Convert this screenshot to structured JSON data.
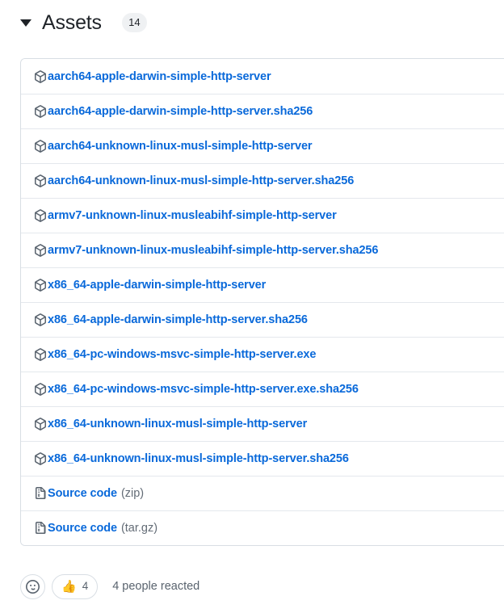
{
  "assets_section": {
    "title": "Assets",
    "count": "14",
    "disclosure_state": "expanded",
    "disclosure_icon": "triangle-down-icon"
  },
  "assets": [
    {
      "icon": "package-icon",
      "name": "aarch64-apple-darwin-simple-http-server",
      "suffix": ""
    },
    {
      "icon": "package-icon",
      "name": "aarch64-apple-darwin-simple-http-server.sha256",
      "suffix": ""
    },
    {
      "icon": "package-icon",
      "name": "aarch64-unknown-linux-musl-simple-http-server",
      "suffix": ""
    },
    {
      "icon": "package-icon",
      "name": "aarch64-unknown-linux-musl-simple-http-server.sha256",
      "suffix": ""
    },
    {
      "icon": "package-icon",
      "name": "armv7-unknown-linux-musleabihf-simple-http-server",
      "suffix": ""
    },
    {
      "icon": "package-icon",
      "name": "armv7-unknown-linux-musleabihf-simple-http-server.sha256",
      "suffix": ""
    },
    {
      "icon": "package-icon",
      "name": "x86_64-apple-darwin-simple-http-server",
      "suffix": ""
    },
    {
      "icon": "package-icon",
      "name": "x86_64-apple-darwin-simple-http-server.sha256",
      "suffix": ""
    },
    {
      "icon": "package-icon",
      "name": "x86_64-pc-windows-msvc-simple-http-server.exe",
      "suffix": ""
    },
    {
      "icon": "package-icon",
      "name": "x86_64-pc-windows-msvc-simple-http-server.exe.sha256",
      "suffix": ""
    },
    {
      "icon": "package-icon",
      "name": "x86_64-unknown-linux-musl-simple-http-server",
      "suffix": ""
    },
    {
      "icon": "package-icon",
      "name": "x86_64-unknown-linux-musl-simple-http-server.sha256",
      "suffix": ""
    },
    {
      "icon": "file-zip-icon",
      "name": "Source code",
      "suffix": "(zip)"
    },
    {
      "icon": "file-zip-icon",
      "name": "Source code",
      "suffix": "(tar.gz)"
    }
  ],
  "reactions": {
    "add_reaction_icon": "smiley-icon",
    "items": [
      {
        "emoji": "👍",
        "icon": "thumbs-up-icon",
        "count": "4"
      }
    ],
    "summary": "4 people reacted"
  },
  "colors": {
    "link": "#0969da",
    "border": "#d8dee4",
    "row_divider": "#e4e8ed",
    "muted_text": "#59636e",
    "badge_bg": "#eff1f3",
    "text": "#1f2328"
  }
}
